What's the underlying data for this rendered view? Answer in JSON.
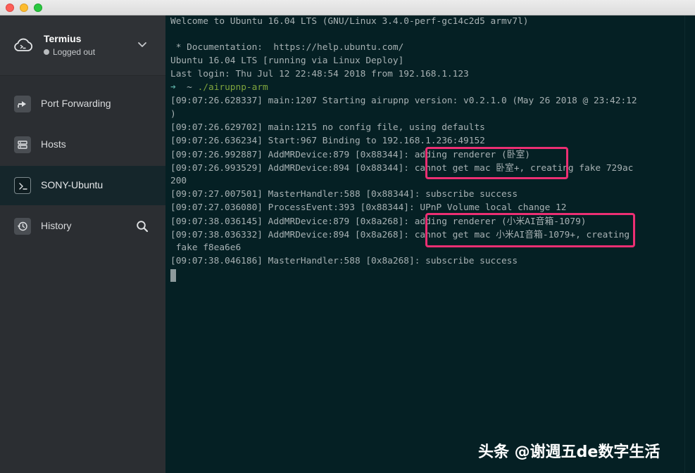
{
  "sidebar": {
    "account": {
      "name": "Termius",
      "status": "Logged out"
    },
    "items": [
      {
        "label": "Port Forwarding",
        "icon": "port-forwarding-icon"
      },
      {
        "label": "Hosts",
        "icon": "hosts-icon"
      },
      {
        "label": "SONY-Ubuntu",
        "icon": "terminal-icon",
        "active": true
      },
      {
        "label": "History",
        "icon": "history-icon"
      }
    ]
  },
  "terminal": {
    "lines": [
      "Welcome to Ubuntu 16.04 LTS (GNU/Linux 3.4.0-perf-gc14c2d5 armv7l)",
      "",
      " * Documentation:  https://help.ubuntu.com/",
      "Ubuntu 16.04 LTS [running via Linux Deploy]",
      "Last login: Thu Jul 12 22:48:54 2018 from 192.168.1.123",
      "",
      "[09:07:26.628337] main:1207 Starting airupnp version: v0.2.1.0 (May 26 2018 @ 23:42:12",
      ")",
      "[09:07:26.629702] main:1215 no config file, using defaults",
      "[09:07:26.636234] Start:967 Binding to 192.168.1.236:49152",
      "[09:07:26.992887] AddMRDevice:879 [0x88344]: adding renderer (卧室)",
      "[09:07:26.993529] AddMRDevice:894 [0x88344]: cannot get mac 卧室+, creating fake 729ac",
      "200",
      "[09:07:27.007501] MasterHandler:588 [0x88344]: subscribe success",
      "[09:07:27.036080] ProcessEvent:393 [0x88344]: UPnP Volume local change 12",
      "[09:07:38.036145] AddMRDevice:879 [0x8a268]: adding renderer (小米AI音箱-1079)",
      "[09:07:38.036332] AddMRDevice:894 [0x8a268]: cannot get mac 小米AI音箱-1079+, creating",
      " fake f8ea6e6",
      "[09:07:38.046186] MasterHandler:588 [0x8a268]: subscribe success"
    ],
    "prompt": {
      "arrow": "➜",
      "dir": "~",
      "command": "./airupnp-arm"
    }
  },
  "watermark": "头条 @谢週五de数字生活",
  "colors": {
    "sidebar_bg": "#2b2e32",
    "active_item_bg": "#15262b",
    "terminal_bg": "#052024",
    "terminal_text": "#a7b1b3",
    "command_green": "#7fa53d",
    "highlight_pink": "#ec2f73"
  }
}
